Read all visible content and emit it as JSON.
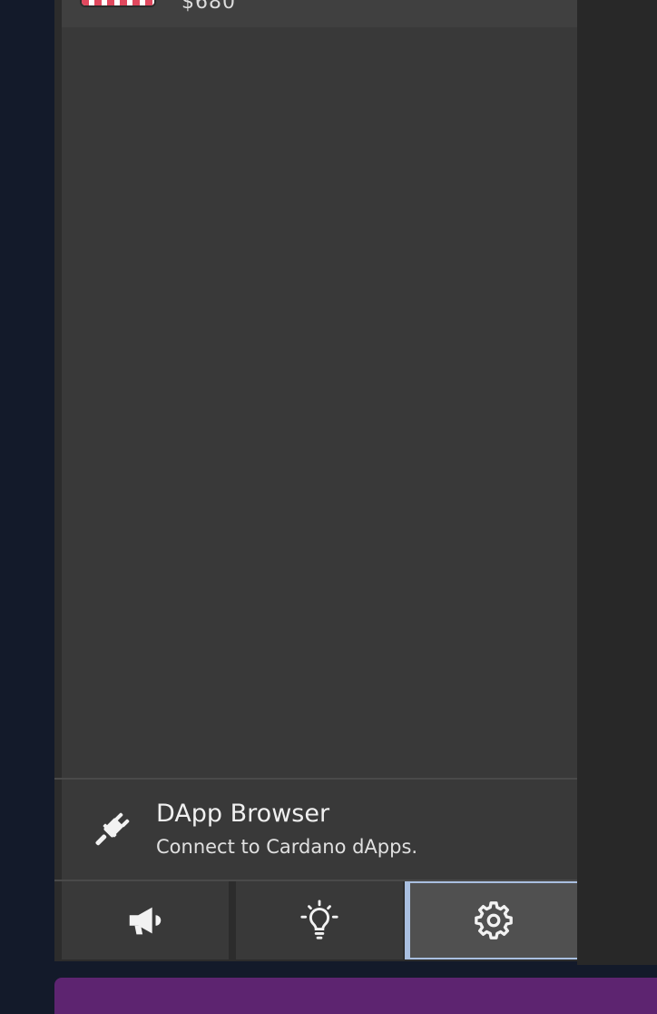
{
  "asset": {
    "amount": "$680",
    "icon": "flag-icon"
  },
  "dapp_browser": {
    "title": "DApp Browser",
    "subtitle": "Connect to Cardano dApps.",
    "icon": "plug-icon"
  },
  "toolbar": {
    "buttons": [
      {
        "icon": "megaphone-icon"
      },
      {
        "icon": "lightbulb-icon"
      },
      {
        "icon": "gear-icon",
        "selected": true
      }
    ]
  },
  "colors": {
    "background": "#131a2a",
    "panel": "#393939",
    "selected_border": "#a9bfe0",
    "bottom_bar": "#5d2470"
  }
}
